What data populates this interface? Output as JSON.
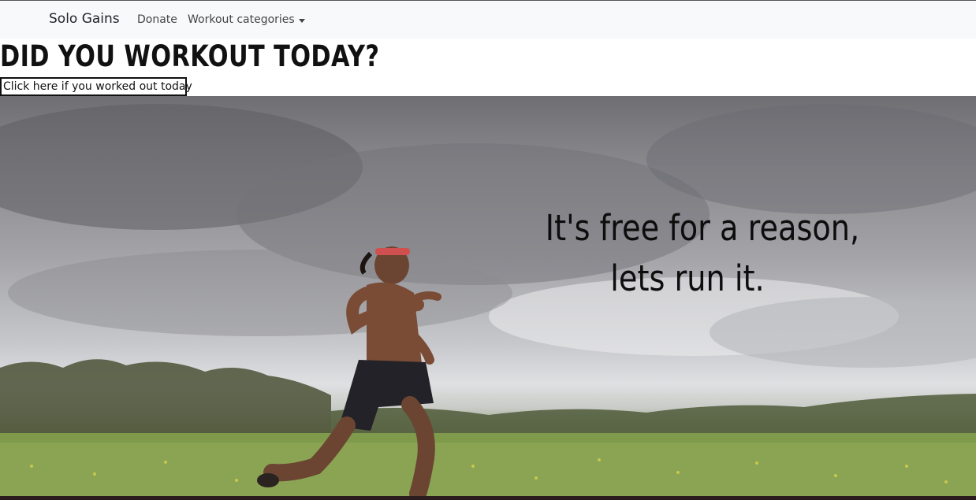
{
  "navbar": {
    "brand": "Solo Gains",
    "links": [
      {
        "label": "Donate"
      },
      {
        "label": "Workout categories"
      }
    ]
  },
  "main": {
    "headline": "DID YOU WORKOUT TODAY?",
    "button_label": "Click here if you worked out today"
  },
  "hero": {
    "quote_line1": "It's free for a reason,",
    "quote_line2": "lets run it."
  },
  "colors": {
    "navbar_bg": "#f8f9fa",
    "text": "#111111"
  }
}
